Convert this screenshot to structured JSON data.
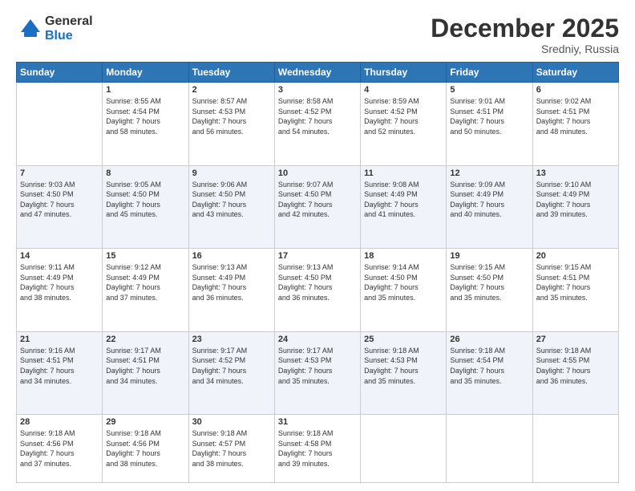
{
  "logo": {
    "general": "General",
    "blue": "Blue"
  },
  "title": "December 2025",
  "location": "Sredniy, Russia",
  "days_header": [
    "Sunday",
    "Monday",
    "Tuesday",
    "Wednesday",
    "Thursday",
    "Friday",
    "Saturday"
  ],
  "weeks": [
    [
      {
        "day": "",
        "info": ""
      },
      {
        "day": "1",
        "info": "Sunrise: 8:55 AM\nSunset: 4:54 PM\nDaylight: 7 hours\nand 58 minutes."
      },
      {
        "day": "2",
        "info": "Sunrise: 8:57 AM\nSunset: 4:53 PM\nDaylight: 7 hours\nand 56 minutes."
      },
      {
        "day": "3",
        "info": "Sunrise: 8:58 AM\nSunset: 4:52 PM\nDaylight: 7 hours\nand 54 minutes."
      },
      {
        "day": "4",
        "info": "Sunrise: 8:59 AM\nSunset: 4:52 PM\nDaylight: 7 hours\nand 52 minutes."
      },
      {
        "day": "5",
        "info": "Sunrise: 9:01 AM\nSunset: 4:51 PM\nDaylight: 7 hours\nand 50 minutes."
      },
      {
        "day": "6",
        "info": "Sunrise: 9:02 AM\nSunset: 4:51 PM\nDaylight: 7 hours\nand 48 minutes."
      }
    ],
    [
      {
        "day": "7",
        "info": "Sunrise: 9:03 AM\nSunset: 4:50 PM\nDaylight: 7 hours\nand 47 minutes."
      },
      {
        "day": "8",
        "info": "Sunrise: 9:05 AM\nSunset: 4:50 PM\nDaylight: 7 hours\nand 45 minutes."
      },
      {
        "day": "9",
        "info": "Sunrise: 9:06 AM\nSunset: 4:50 PM\nDaylight: 7 hours\nand 43 minutes."
      },
      {
        "day": "10",
        "info": "Sunrise: 9:07 AM\nSunset: 4:50 PM\nDaylight: 7 hours\nand 42 minutes."
      },
      {
        "day": "11",
        "info": "Sunrise: 9:08 AM\nSunset: 4:49 PM\nDaylight: 7 hours\nand 41 minutes."
      },
      {
        "day": "12",
        "info": "Sunrise: 9:09 AM\nSunset: 4:49 PM\nDaylight: 7 hours\nand 40 minutes."
      },
      {
        "day": "13",
        "info": "Sunrise: 9:10 AM\nSunset: 4:49 PM\nDaylight: 7 hours\nand 39 minutes."
      }
    ],
    [
      {
        "day": "14",
        "info": "Sunrise: 9:11 AM\nSunset: 4:49 PM\nDaylight: 7 hours\nand 38 minutes."
      },
      {
        "day": "15",
        "info": "Sunrise: 9:12 AM\nSunset: 4:49 PM\nDaylight: 7 hours\nand 37 minutes."
      },
      {
        "day": "16",
        "info": "Sunrise: 9:13 AM\nSunset: 4:49 PM\nDaylight: 7 hours\nand 36 minutes."
      },
      {
        "day": "17",
        "info": "Sunrise: 9:13 AM\nSunset: 4:50 PM\nDaylight: 7 hours\nand 36 minutes."
      },
      {
        "day": "18",
        "info": "Sunrise: 9:14 AM\nSunset: 4:50 PM\nDaylight: 7 hours\nand 35 minutes."
      },
      {
        "day": "19",
        "info": "Sunrise: 9:15 AM\nSunset: 4:50 PM\nDaylight: 7 hours\nand 35 minutes."
      },
      {
        "day": "20",
        "info": "Sunrise: 9:15 AM\nSunset: 4:51 PM\nDaylight: 7 hours\nand 35 minutes."
      }
    ],
    [
      {
        "day": "21",
        "info": "Sunrise: 9:16 AM\nSunset: 4:51 PM\nDaylight: 7 hours\nand 34 minutes."
      },
      {
        "day": "22",
        "info": "Sunrise: 9:17 AM\nSunset: 4:51 PM\nDaylight: 7 hours\nand 34 minutes."
      },
      {
        "day": "23",
        "info": "Sunrise: 9:17 AM\nSunset: 4:52 PM\nDaylight: 7 hours\nand 34 minutes."
      },
      {
        "day": "24",
        "info": "Sunrise: 9:17 AM\nSunset: 4:53 PM\nDaylight: 7 hours\nand 35 minutes."
      },
      {
        "day": "25",
        "info": "Sunrise: 9:18 AM\nSunset: 4:53 PM\nDaylight: 7 hours\nand 35 minutes."
      },
      {
        "day": "26",
        "info": "Sunrise: 9:18 AM\nSunset: 4:54 PM\nDaylight: 7 hours\nand 35 minutes."
      },
      {
        "day": "27",
        "info": "Sunrise: 9:18 AM\nSunset: 4:55 PM\nDaylight: 7 hours\nand 36 minutes."
      }
    ],
    [
      {
        "day": "28",
        "info": "Sunrise: 9:18 AM\nSunset: 4:56 PM\nDaylight: 7 hours\nand 37 minutes."
      },
      {
        "day": "29",
        "info": "Sunrise: 9:18 AM\nSunset: 4:56 PM\nDaylight: 7 hours\nand 38 minutes."
      },
      {
        "day": "30",
        "info": "Sunrise: 9:18 AM\nSunset: 4:57 PM\nDaylight: 7 hours\nand 38 minutes."
      },
      {
        "day": "31",
        "info": "Sunrise: 9:18 AM\nSunset: 4:58 PM\nDaylight: 7 hours\nand 39 minutes."
      },
      {
        "day": "",
        "info": ""
      },
      {
        "day": "",
        "info": ""
      },
      {
        "day": "",
        "info": ""
      }
    ]
  ]
}
